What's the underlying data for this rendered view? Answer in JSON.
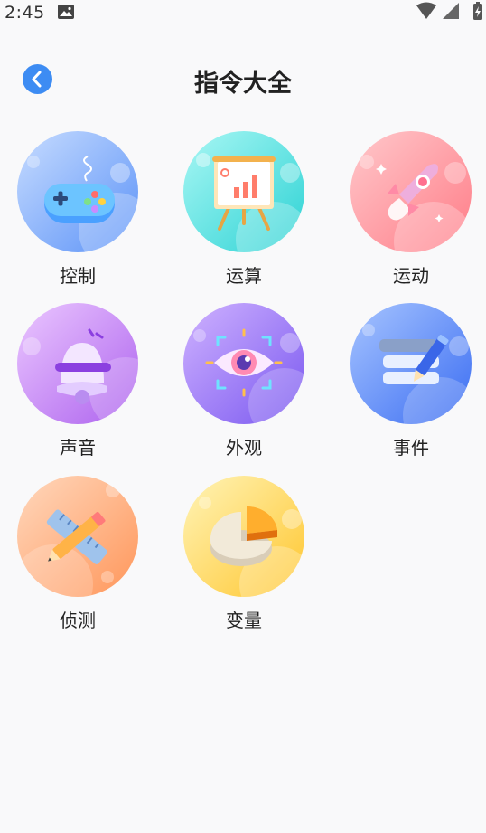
{
  "status_bar": {
    "time": "2:45"
  },
  "header": {
    "title": "指令大全"
  },
  "categories": [
    {
      "label": "控制",
      "icon": "gamepad-icon",
      "gradient": [
        "#b9d4ff",
        "#5e95f8"
      ]
    },
    {
      "label": "运算",
      "icon": "presentation-board-icon",
      "gradient": [
        "#9ff4f2",
        "#2fd4d6"
      ]
    },
    {
      "label": "运动",
      "icon": "rocket-icon",
      "gradient": [
        "#ffc1c4",
        "#ff7d88"
      ]
    },
    {
      "label": "声音",
      "icon": "bell-icon",
      "gradient": [
        "#e6bcff",
        "#b06af0"
      ]
    },
    {
      "label": "外观",
      "icon": "eye-icon",
      "gradient": [
        "#c7a7ff",
        "#7c5cf2"
      ]
    },
    {
      "label": "事件",
      "icon": "document-pencil-icon",
      "gradient": [
        "#94b8ff",
        "#3f70f2"
      ]
    },
    {
      "label": "侦测",
      "icon": "ruler-pencil-icon",
      "gradient": [
        "#ffd1b0",
        "#ff9a60"
      ]
    },
    {
      "label": "变量",
      "icon": "pie-chart-icon",
      "gradient": [
        "#fff2a8",
        "#ffc93a"
      ]
    }
  ],
  "colors": {
    "accent": "#3d8cf3",
    "background": "#f9f9fa"
  }
}
